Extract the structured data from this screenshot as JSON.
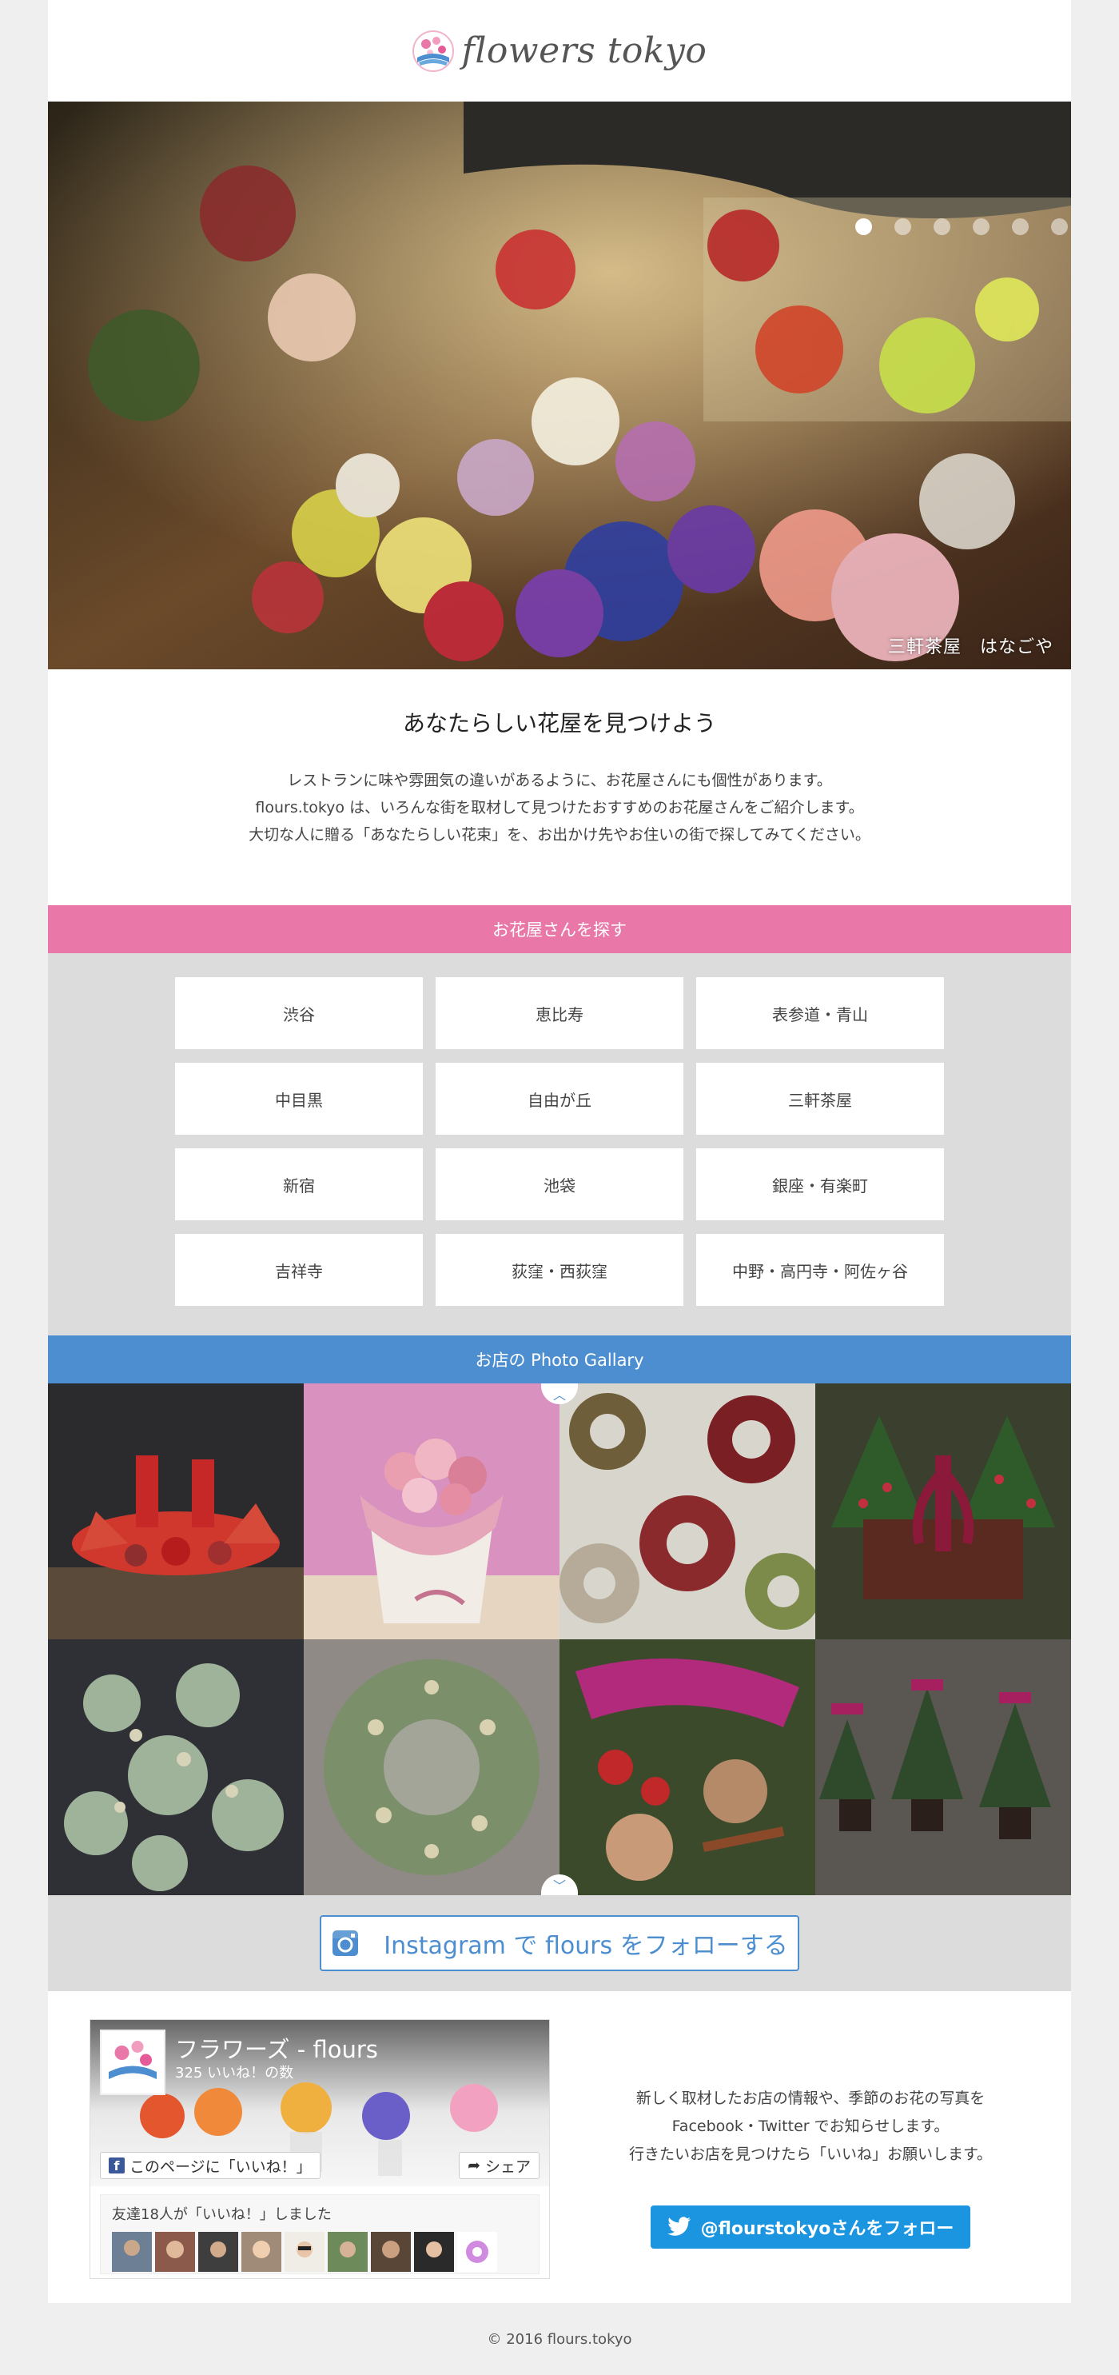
{
  "header": {
    "logo_text": "flowers tokyo"
  },
  "hero": {
    "caption": "三軒茶屋　はなごや",
    "slide_count": 6,
    "active_slide": 1
  },
  "intro": {
    "heading": "あなたらしい花屋を見つけよう",
    "lines": [
      "レストランに味や雰囲気の違いがあるように、お花屋さんにも個性があります。",
      "flours.tokyo は、いろんな街を取材して見つけたおすすめのお花屋さんをご紹介します。",
      "大切な人に贈る「あなたらしい花束」を、お出かけ先やお住いの街で探してみてください。"
    ]
  },
  "areas": {
    "title": "お花屋さんを探す",
    "items": [
      "渋谷",
      "恵比寿",
      "表参道・青山",
      "中目黒",
      "自由が丘",
      "三軒茶屋",
      "新宿",
      "池袋",
      "銀座・有楽町",
      "吉祥寺",
      "荻窪・西荻窪",
      "中野・高円寺・阿佐ヶ谷"
    ]
  },
  "gallery": {
    "title": "お店の Photo Gallary",
    "up_icon": "chevron-up-icon",
    "down_icon": "chevron-down-icon"
  },
  "instagram": {
    "label": "Instagram で flours をフォローする",
    "icon": "instagram-icon"
  },
  "facebook": {
    "page_name": "フラワーズ - flours",
    "likes": "325 いいね！の数",
    "like_button": "このページに「いいね！」",
    "share_button": "シェア",
    "friends_text": "友達18人が「いいね！」しました"
  },
  "follow": {
    "lines": [
      "新しく取材したお店の情報や、季節のお花の写真を",
      "Facebook・Twitter でお知らせします。",
      "行きたいお店を見つけたら「いいね」お願いします。"
    ],
    "twitter_button": "@flourstokyoさんをフォロー"
  },
  "footer": {
    "copyright": "© 2016 flours.tokyo"
  },
  "colors": {
    "pink": "#e977a8",
    "blue": "#4c8ecf",
    "twitter": "#1b95e0",
    "facebook": "#3b5998"
  }
}
